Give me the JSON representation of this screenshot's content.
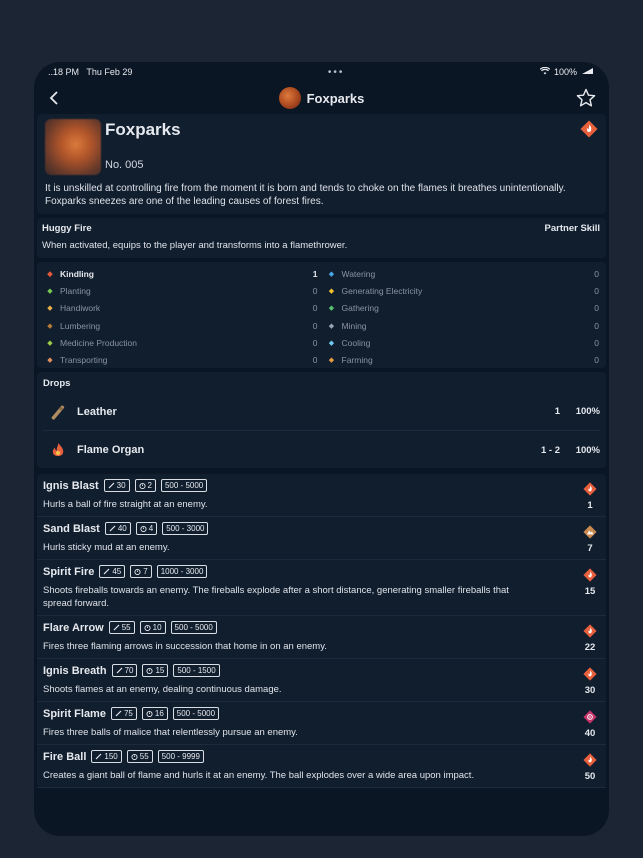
{
  "status": {
    "time": "..18 PM",
    "date": "Thu Feb 29",
    "dots": "•••",
    "battery": "100%"
  },
  "nav": {
    "title": "Foxparks",
    "back_icon": "chevron-left-icon",
    "star_icon": "star-icon"
  },
  "pal": {
    "name": "Foxparks",
    "number": "No. 005",
    "element": "fire",
    "description": "It is unskilled at controlling fire from the moment it is born and tends to choke on the flames it breathes unintentionally. Foxparks sneezes are one of the leading causes of forest fires."
  },
  "partner_skill": {
    "name": "Huggy Fire",
    "kind": "Partner Skill",
    "description": "When activated, equips to the player and transforms into a flamethrower."
  },
  "work": {
    "left": [
      {
        "name": "Kindling",
        "value": "1",
        "active": true,
        "icon": "flame-icon",
        "color": "#e2583a"
      },
      {
        "name": "Planting",
        "value": "0",
        "active": false,
        "icon": "sprout-icon",
        "color": "#78c850"
      },
      {
        "name": "Handiwork",
        "value": "0",
        "active": false,
        "icon": "hand-icon",
        "color": "#e8b04a"
      },
      {
        "name": "Lumbering",
        "value": "0",
        "active": false,
        "icon": "log-icon",
        "color": "#b87a3a"
      },
      {
        "name": "Medicine Production",
        "value": "0",
        "active": false,
        "icon": "medicine-icon",
        "color": "#9ccc46"
      },
      {
        "name": "Transporting",
        "value": "0",
        "active": false,
        "icon": "box-icon",
        "color": "#e0905a"
      }
    ],
    "right": [
      {
        "name": "Watering",
        "value": "0",
        "active": false,
        "icon": "water-icon",
        "color": "#4aa8e8"
      },
      {
        "name": "Generating Electricity",
        "value": "0",
        "active": false,
        "icon": "bolt-icon",
        "color": "#f0c030"
      },
      {
        "name": "Gathering",
        "value": "0",
        "active": false,
        "icon": "leaf-icon",
        "color": "#58c070"
      },
      {
        "name": "Mining",
        "value": "0",
        "active": false,
        "icon": "pickaxe-icon",
        "color": "#9aa3b0"
      },
      {
        "name": "Cooling",
        "value": "0",
        "active": false,
        "icon": "snowflake-icon",
        "color": "#70c8f0"
      },
      {
        "name": "Farming",
        "value": "0",
        "active": false,
        "icon": "farm-icon",
        "color": "#e89a40"
      }
    ]
  },
  "drops": {
    "title": "Drops",
    "items": [
      {
        "name": "Leather",
        "qty": "1",
        "rate": "100%",
        "icon": "leather-icon"
      },
      {
        "name": "Flame Organ",
        "qty": "1 - 2",
        "rate": "100%",
        "icon": "flame-organ-icon"
      }
    ]
  },
  "moves": [
    {
      "name": "Ignis Blast",
      "power": "30",
      "cooldown": "2",
      "range": "500 - 5000",
      "desc": "Hurls a ball of fire straight at an enemy.",
      "level": "1",
      "element": "fire"
    },
    {
      "name": "Sand Blast",
      "power": "40",
      "cooldown": "4",
      "range": "500 - 3000",
      "desc": "Hurls sticky mud at an enemy.",
      "level": "7",
      "element": "ground"
    },
    {
      "name": "Spirit Fire",
      "power": "45",
      "cooldown": "7",
      "range": "1000 - 3000",
      "desc": "Shoots fireballs towards an enemy. The fireballs explode after a short distance, generating smaller fireballs that spread forward.",
      "level": "15",
      "element": "fire"
    },
    {
      "name": "Flare Arrow",
      "power": "55",
      "cooldown": "10",
      "range": "500 - 5000",
      "desc": "Fires three flaming arrows in succession that home in on an enemy.",
      "level": "22",
      "element": "fire"
    },
    {
      "name": "Ignis Breath",
      "power": "70",
      "cooldown": "15",
      "range": "500 - 1500",
      "desc": "Shoots flames at an enemy, dealing continuous damage.",
      "level": "30",
      "element": "fire"
    },
    {
      "name": "Spirit Flame",
      "power": "75",
      "cooldown": "16",
      "range": "500 - 5000",
      "desc": "Fires three balls of malice that relentlessly pursue an enemy.",
      "level": "40",
      "element": "dark"
    },
    {
      "name": "Fire Ball",
      "power": "150",
      "cooldown": "55",
      "range": "500 - 9999",
      "desc": "Creates a giant ball of flame and hurls it at an enemy. The ball explodes over a wide area upon impact.",
      "level": "50",
      "element": "fire"
    }
  ],
  "colors": {
    "fire": "#e8603c",
    "ground": "#c98a50",
    "dark": "#c8346a",
    "background": "#0b1624",
    "card": "#111e2e"
  }
}
